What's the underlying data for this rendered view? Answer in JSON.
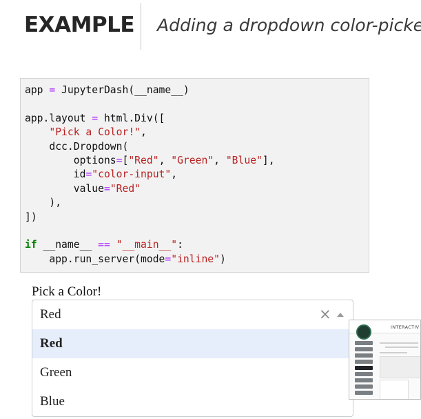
{
  "header": {
    "title": "EXAMPLE",
    "subtitle": "Adding a dropdown color-picker"
  },
  "code": {
    "l1_a": "app ",
    "l1_op": "=",
    "l1_b": " JupyterDash(__name__)",
    "l3_a": "app.layout ",
    "l3_op": "=",
    "l3_b": " html.Div([",
    "l4_str": "\"Pick a Color!\"",
    "l4_b": ",",
    "l5": "dcc.Dropdown(",
    "l6_a": "options",
    "l6_op": "=",
    "l6_b": "[",
    "l6_s1": "\"Red\"",
    "l6_c1": ", ",
    "l6_s2": "\"Green\"",
    "l6_c2": ", ",
    "l6_s3": "\"Blue\"",
    "l6_end": "],",
    "l7_a": "id",
    "l7_op": "=",
    "l7_str": "\"color-input\"",
    "l7_end": ",",
    "l8_a": "value",
    "l8_op": "=",
    "l8_str": "\"Red\"",
    "l9": "),",
    "l10": "])",
    "l12_kw": "if",
    "l12_a": " __name__ ",
    "l12_op": "==",
    "l12_sp": " ",
    "l12_str": "\"__main__\"",
    "l12_end": ":",
    "l13_a": "app.run_server(mode",
    "l13_op": "=",
    "l13_str": "\"inline\"",
    "l13_end": ")"
  },
  "app": {
    "label": "Pick a Color!",
    "dropdown": {
      "value": "Red",
      "clear_symbol": "×",
      "options": [
        "Red",
        "Green",
        "Blue"
      ],
      "highlighted": "Red"
    }
  },
  "thumbnail": {
    "heading": "INTERACTIV",
    "logo_icon": "logo-icon"
  }
}
